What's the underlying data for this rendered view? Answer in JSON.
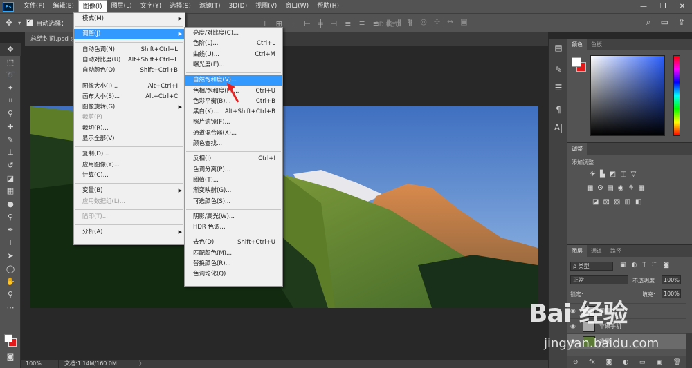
{
  "menubar": {
    "logo": "Ps",
    "items": [
      "文件(F)",
      "编辑(E)",
      "图像(I)",
      "图层(L)",
      "文字(Y)",
      "选择(S)",
      "滤镜(T)",
      "3D(D)",
      "视图(V)",
      "窗口(W)",
      "帮助(H)"
    ],
    "window_controls": [
      "—",
      "❐",
      "✕"
    ]
  },
  "options": {
    "auto_select_label": "自动选择：",
    "mode3d_label": "3D 模式："
  },
  "document": {
    "tab_title": "总结封面.psd @"
  },
  "status": {
    "zoom": "100%",
    "doc_size": "文档:1.14M/160.0M",
    "arrow": "〉"
  },
  "image_menu": {
    "items": [
      {
        "label": "模式(M)",
        "shortcut": "",
        "submenu": true,
        "disabled": false,
        "highlight": false
      },
      {
        "sep": true
      },
      {
        "label": "调整(J)",
        "shortcut": "",
        "submenu": true,
        "disabled": false,
        "highlight": true
      },
      {
        "sep": true
      },
      {
        "label": "自动色调(N)",
        "shortcut": "Shift+Ctrl+L"
      },
      {
        "label": "自动对比度(U)",
        "shortcut": "Alt+Shift+Ctrl+L"
      },
      {
        "label": "自动颜色(O)",
        "shortcut": "Shift+Ctrl+B"
      },
      {
        "sep": true
      },
      {
        "label": "图像大小(I)...",
        "shortcut": "Alt+Ctrl+I"
      },
      {
        "label": "画布大小(S)...",
        "shortcut": "Alt+Ctrl+C"
      },
      {
        "label": "图像旋转(G)",
        "shortcut": "",
        "submenu": true
      },
      {
        "label": "裁剪(P)",
        "shortcut": "",
        "disabled": true
      },
      {
        "label": "裁切(R)...",
        "shortcut": ""
      },
      {
        "label": "显示全部(V)",
        "shortcut": ""
      },
      {
        "sep": true
      },
      {
        "label": "复制(D)...",
        "shortcut": ""
      },
      {
        "label": "应用图像(Y)...",
        "shortcut": ""
      },
      {
        "label": "计算(C)...",
        "shortcut": ""
      },
      {
        "sep": true
      },
      {
        "label": "变量(B)",
        "shortcut": "",
        "submenu": true
      },
      {
        "label": "应用数据组(L)...",
        "shortcut": "",
        "disabled": true
      },
      {
        "sep": true
      },
      {
        "label": "陷印(T)...",
        "shortcut": "",
        "disabled": true
      },
      {
        "sep": true
      },
      {
        "label": "分析(A)",
        "shortcut": "",
        "submenu": true
      }
    ]
  },
  "adjust_menu": {
    "items": [
      {
        "label": "亮度/对比度(C)...",
        "shortcut": ""
      },
      {
        "label": "色阶(L)...",
        "shortcut": "Ctrl+L"
      },
      {
        "label": "曲线(U)...",
        "shortcut": "Ctrl+M"
      },
      {
        "label": "曝光度(E)...",
        "shortcut": ""
      },
      {
        "sep": true
      },
      {
        "label": "自然饱和度(V)...",
        "shortcut": "",
        "highlight": true
      },
      {
        "label": "色相/饱和度(H)...",
        "shortcut": "Ctrl+U"
      },
      {
        "label": "色彩平衡(B)...",
        "shortcut": "Ctrl+B"
      },
      {
        "label": "黑白(K)...",
        "shortcut": "Alt+Shift+Ctrl+B"
      },
      {
        "label": "照片滤镜(F)...",
        "shortcut": ""
      },
      {
        "label": "通道混合器(X)...",
        "shortcut": ""
      },
      {
        "label": "颜色查找...",
        "shortcut": ""
      },
      {
        "sep": true
      },
      {
        "label": "反相(I)",
        "shortcut": "Ctrl+I"
      },
      {
        "label": "色调分离(P)...",
        "shortcut": ""
      },
      {
        "label": "阈值(T)...",
        "shortcut": ""
      },
      {
        "label": "渐变映射(G)...",
        "shortcut": ""
      },
      {
        "label": "可选颜色(S)...",
        "shortcut": ""
      },
      {
        "sep": true
      },
      {
        "label": "阴影/高光(W)...",
        "shortcut": ""
      },
      {
        "label": "HDR 色调...",
        "shortcut": ""
      },
      {
        "sep": true
      },
      {
        "label": "去色(D)",
        "shortcut": "Shift+Ctrl+U"
      },
      {
        "label": "匹配颜色(M)...",
        "shortcut": ""
      },
      {
        "label": "替换颜色(R)...",
        "shortcut": ""
      },
      {
        "label": "色调均化(Q)",
        "shortcut": ""
      }
    ]
  },
  "panels": {
    "color_tabs": [
      "颜色",
      "色板"
    ],
    "adjust_tab": "调整",
    "adjust_add_label": "添加调整",
    "layers_tabs": [
      "图层",
      "通道",
      "路径"
    ],
    "layer_filter": "ρ 类型",
    "blend_mode": "正常",
    "opacity_label": "不透明度:",
    "opacity_value": "100%",
    "lock_label": "锁定:",
    "fill_label": "填充:",
    "fill_value": "100%",
    "layers": [
      {
        "name": "图层 1"
      },
      {
        "name": "苹果手机"
      },
      {
        "name": "背景"
      }
    ]
  },
  "watermark": {
    "logo": "Bai 经验",
    "url": "jingyan.baidu.com"
  },
  "colors": {
    "highlight": "#3399ff",
    "foreground": "#ffffff",
    "background": "#e01a1a"
  }
}
